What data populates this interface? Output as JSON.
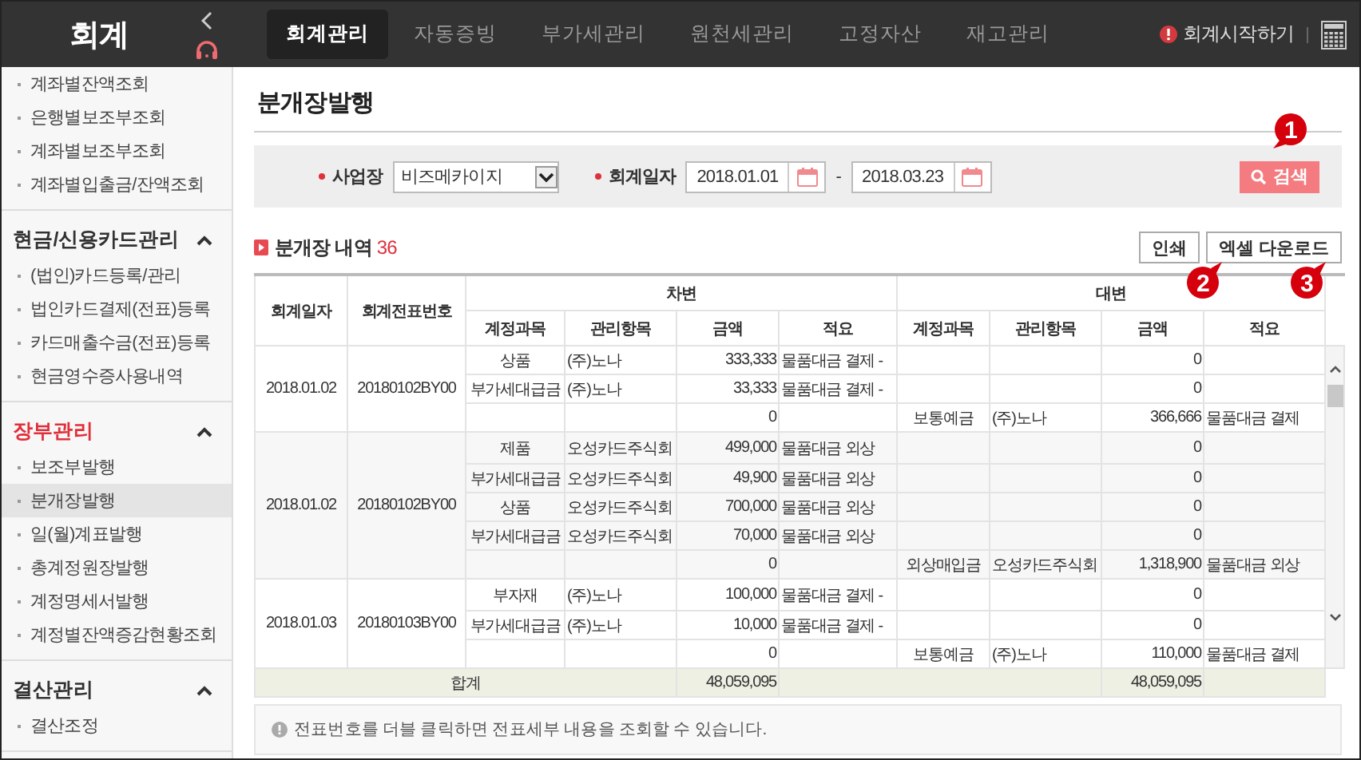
{
  "app": {
    "title": "회계"
  },
  "top_tabs": [
    {
      "label": "회계관리",
      "selected": true
    },
    {
      "label": "자동증빙",
      "selected": false
    },
    {
      "label": "부가세관리",
      "selected": false
    },
    {
      "label": "원천세관리",
      "selected": false
    },
    {
      "label": "고정자산",
      "selected": false
    },
    {
      "label": "재고관리",
      "selected": false
    }
  ],
  "start_link": "회계시작하기",
  "sidebar": [
    {
      "items": [
        {
          "label": "계좌별잔액조회",
          "selected": false
        },
        {
          "label": "은행별보조부조회",
          "selected": false
        },
        {
          "label": "계좌별보조부조회",
          "selected": false
        },
        {
          "label": "계좌별입출금/잔액조회",
          "selected": false
        }
      ]
    },
    {
      "title": "현금/신용카드관리",
      "selected": false,
      "expanded": true,
      "items": [
        {
          "label": "(법인)카드등록/관리",
          "selected": false
        },
        {
          "label": "법인카드결제(전표)등록",
          "selected": false
        },
        {
          "label": "카드매출수금(전표)등록",
          "selected": false
        },
        {
          "label": "현금영수증사용내역",
          "selected": false
        }
      ]
    },
    {
      "title": "장부관리",
      "selected": true,
      "expanded": true,
      "items": [
        {
          "label": "보조부발행",
          "selected": false
        },
        {
          "label": "분개장발행",
          "selected": true
        },
        {
          "label": "일(월)계표발행",
          "selected": false
        },
        {
          "label": "총계정원장발행",
          "selected": false
        },
        {
          "label": "계정명세서발행",
          "selected": false
        },
        {
          "label": "계정별잔액증감현황조회",
          "selected": false
        }
      ]
    },
    {
      "title": "결산관리",
      "selected": false,
      "expanded": true,
      "items": [
        {
          "label": "결산조정",
          "selected": false
        }
      ]
    }
  ],
  "page_title": "분개장발행",
  "search": {
    "business_label": "사업장",
    "business_value": "비즈메카이지",
    "date_label": "회계일자",
    "date_from": "2018.01.01",
    "date_separator": "-",
    "date_to": "2018.03.23",
    "button": "검색"
  },
  "section": {
    "title": "분개장 내역",
    "count": "36"
  },
  "buttons": [
    "인쇄",
    "엑셀 다운로드"
  ],
  "callouts": [
    "1",
    "2",
    "3"
  ],
  "table": {
    "columns": [
      "회계일자",
      "회계전표번호"
    ],
    "debit_header": "차변",
    "credit_header": "대변",
    "sub_columns": [
      "계정과목",
      "관리항목",
      "금액",
      "적요",
      "계정과목",
      "관리항목",
      "금액",
      "적요"
    ],
    "groups": [
      {
        "date": "2018.01.02",
        "voucher": "20180102BY00",
        "lines": [
          {
            "cells": [
              "상품",
              "(주)노나",
              "333,333",
              "물품대금 결제 -",
              "",
              "",
              "0",
              ""
            ]
          },
          {
            "cells": [
              "부가세대급금",
              "(주)노나",
              "33,333",
              "물품대금 결제 -",
              "",
              "",
              "0",
              ""
            ]
          },
          {
            "cells": [
              "",
              "",
              "0",
              "",
              "보통예금",
              "(주)노나",
              "366,666",
              "물품대금 결제"
            ]
          }
        ]
      },
      {
        "date": "2018.01.02",
        "voucher": "20180102BY00",
        "lines": [
          {
            "cells": [
              "제품",
              "오성카드주식회",
              "499,000",
              "물품대금 외상",
              "",
              "",
              "0",
              ""
            ]
          },
          {
            "cells": [
              "부가세대급금",
              "오성카드주식회",
              "49,900",
              "물품대금 외상",
              "",
              "",
              "0",
              ""
            ]
          },
          {
            "cells": [
              "상품",
              "오성카드주식회",
              "700,000",
              "물품대금 외상",
              "",
              "",
              "0",
              ""
            ]
          },
          {
            "cells": [
              "부가세대급금",
              "오성카드주식회",
              "70,000",
              "물품대금 외상",
              "",
              "",
              "0",
              ""
            ]
          },
          {
            "cells": [
              "",
              "",
              "0",
              "",
              "외상매입금",
              "오성카드주식회",
              "1,318,900",
              "물품대금 외상"
            ]
          }
        ]
      },
      {
        "date": "2018.01.03",
        "voucher": "20180103BY00",
        "lines": [
          {
            "cells": [
              "부자재",
              "(주)노나",
              "100,000",
              "물품대금 결제 -",
              "",
              "",
              "0",
              ""
            ]
          },
          {
            "cells": [
              "부가세대급금",
              "(주)노나",
              "10,000",
              "물품대금 결제 -",
              "",
              "",
              "0",
              ""
            ]
          },
          {
            "cells": [
              "",
              "",
              "0",
              "",
              "보통예금",
              "(주)노나",
              "110,000",
              "물품대금 결제"
            ]
          }
        ]
      }
    ],
    "total_label": "합계",
    "debit_total": "48,059,095",
    "credit_total": "48,059,095"
  },
  "note": "전표번호를 더블 클릭하면 전표세부 내용을 조회할 수 있습니다."
}
